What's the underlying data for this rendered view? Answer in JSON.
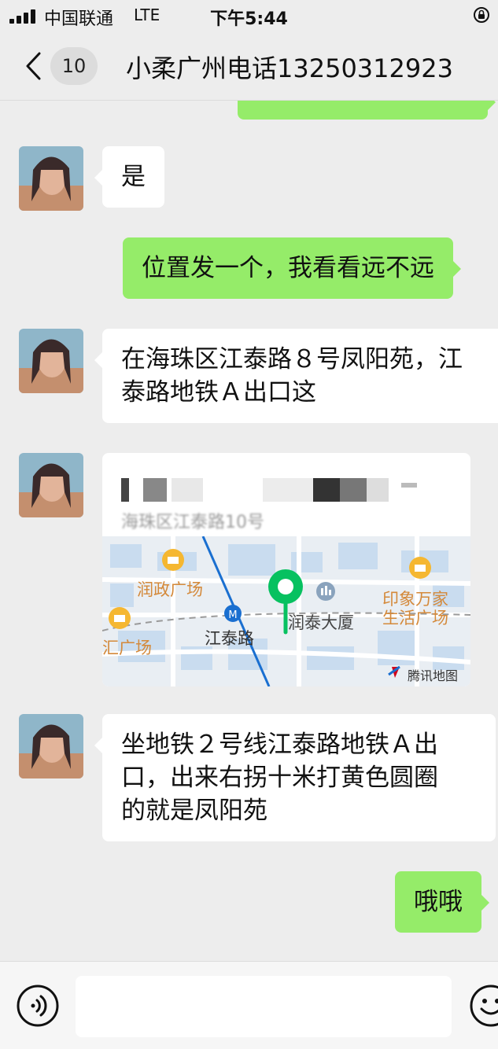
{
  "status_bar": {
    "carrier": "中国联通",
    "network": "LTE",
    "time": "下午5:44"
  },
  "header": {
    "back_icon": "chevron-left-icon",
    "unread_count": "10",
    "title": "小柔广州电话13250312923"
  },
  "messages": [
    {
      "direction": "outgoing",
      "type": "text",
      "text": ""
    },
    {
      "direction": "incoming",
      "type": "text",
      "text": "是"
    },
    {
      "direction": "outgoing",
      "type": "text",
      "text": "位置发一个，我看看远不远"
    },
    {
      "direction": "incoming",
      "type": "text",
      "lines": [
        "在海珠区江泰路８号凤阳苑，江",
        "泰路地铁Ａ出口这"
      ]
    },
    {
      "direction": "incoming",
      "type": "location",
      "address": "海珠区江泰路10号",
      "map": {
        "labels": [
          "润政广场",
          "江泰路",
          "润泰大厦",
          "印象万家",
          "生活广场",
          "汇广场"
        ],
        "provider": "腾讯地图"
      }
    },
    {
      "direction": "incoming",
      "type": "text",
      "lines": [
        "坐地铁２号线江泰路地铁Ａ出",
        "口，出来右拐十米打黄色圆圈",
        "的就是凤阳苑"
      ]
    },
    {
      "direction": "outgoing",
      "type": "text",
      "text": "哦哦"
    }
  ],
  "input_bar": {
    "voice_icon": "voice-icon",
    "input_value": "",
    "emoji_icon": "emoji-icon"
  },
  "colors": {
    "background": "#ededed",
    "incoming_bubble": "#ffffff",
    "outgoing_bubble": "#95ec69",
    "map_pin": "#07c160",
    "poi": "#f5b731"
  }
}
